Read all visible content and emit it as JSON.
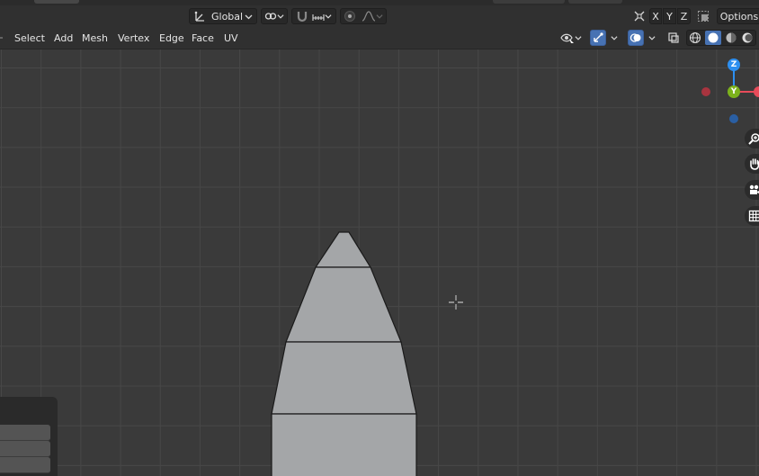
{
  "toolbar": {
    "transform_orientation": "Global",
    "axis_x": "X",
    "axis_y": "Y",
    "axis_z": "Z",
    "options_label": "Options"
  },
  "header_menu": {
    "select": "Select",
    "add": "Add",
    "mesh": "Mesh",
    "vertex": "Vertex",
    "edge": "Edge",
    "face": "Face",
    "uv": "UV"
  },
  "gizmo": {
    "z_label": "Z",
    "y_label": "Y",
    "colors": {
      "x": "#e84b5a",
      "y": "#7cb21c",
      "z": "#2d8ff0",
      "neg_x": "#a8343f",
      "neg_z": "#2a5fa3"
    }
  },
  "navigation": {
    "icons": [
      "zoom-icon",
      "hand-pan-icon",
      "camera-icon",
      "grid-view-icon"
    ]
  },
  "mesh_colors": {
    "fill": "#a4a6a8",
    "edge": "#1a1a1a"
  },
  "colors": {
    "viewport_bg": "#3a3a3a",
    "grid_line": "#474747",
    "accent_blue": "#4772b3"
  }
}
